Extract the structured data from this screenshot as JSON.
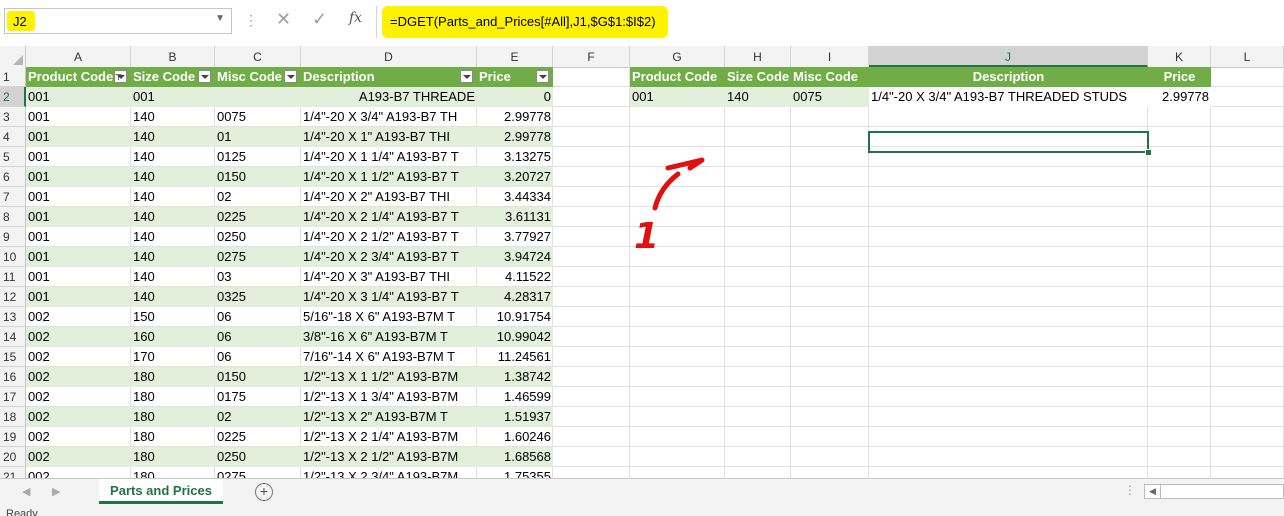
{
  "name_box": "J2",
  "formula": "=DGET(Parts_and_Prices[#All],J1,$G$1:$I$2)",
  "formula_bar_icons": {
    "cancel": "✕",
    "enter": "✓",
    "fx": "fx"
  },
  "columns": [
    "A",
    "B",
    "C",
    "D",
    "E",
    "F",
    "G",
    "H",
    "I",
    "J",
    "K",
    "L"
  ],
  "rows": [
    "1",
    "2",
    "3",
    "4",
    "5",
    "6",
    "7",
    "8",
    "9",
    "10",
    "11",
    "12",
    "13",
    "14",
    "15",
    "16",
    "17",
    "18",
    "19",
    "20",
    "21"
  ],
  "table_headers": [
    "Product Code",
    "Size Code",
    "Misc Code",
    "Description",
    "Price"
  ],
  "table_rows": [
    [
      "001",
      "001",
      "",
      "A193-B7 THREADE",
      "0"
    ],
    [
      "001",
      "140",
      "0075",
      "1/4\"-20 X 3/4\"      A193-B7 TH",
      "2.99778"
    ],
    [
      "001",
      "140",
      "01",
      "1/4\"-20 X 1\"       A193-B7 THI",
      "2.99778"
    ],
    [
      "001",
      "140",
      "0125",
      "1/4\"-20 X 1 1/4\"    A193-B7 T",
      "3.13275"
    ],
    [
      "001",
      "140",
      "0150",
      "1/4\"-20 X 1 1/2\"    A193-B7 T",
      "3.20727"
    ],
    [
      "001",
      "140",
      "02",
      "1/4\"-20 X 2\"       A193-B7 THI",
      "3.44334"
    ],
    [
      "001",
      "140",
      "0225",
      "1/4\"-20 X 2 1/4\"    A193-B7 T",
      "3.61131"
    ],
    [
      "001",
      "140",
      "0250",
      "1/4\"-20 X 2 1/2\"    A193-B7 T",
      "3.77927"
    ],
    [
      "001",
      "140",
      "0275",
      "1/4\"-20 X 2 3/4\"    A193-B7 T",
      "3.94724"
    ],
    [
      "001",
      "140",
      "03",
      "1/4\"-20 X 3\"       A193-B7 THI",
      "4.11522"
    ],
    [
      "001",
      "140",
      "0325",
      "1/4\"-20 X 3 1/4\"    A193-B7 T",
      "4.28317"
    ],
    [
      "002",
      "150",
      "06",
      "5/16\"-18 X 6\"      A193-B7M T",
      "10.91754"
    ],
    [
      "002",
      "160",
      "06",
      "3/8\"-16 X 6\"       A193-B7M T",
      "10.99042"
    ],
    [
      "002",
      "170",
      "06",
      "7/16\"-14 X 6\"      A193-B7M T",
      "11.24561"
    ],
    [
      "002",
      "180",
      "0150",
      "1/2\"-13 X 1 1/2\"    A193-B7M",
      "1.38742"
    ],
    [
      "002",
      "180",
      "0175",
      "1/2\"-13 X 1 3/4\"    A193-B7M",
      "1.46599"
    ],
    [
      "002",
      "180",
      "02",
      "1/2\"-13 X 2\"       A193-B7M T",
      "1.51937"
    ],
    [
      "002",
      "180",
      "0225",
      "1/2\"-13 X 2 1/4\"    A193-B7M",
      "1.60246"
    ],
    [
      "002",
      "180",
      "0250",
      "1/2\"-13 X 2 1/2\"    A193-B7M",
      "1.68568"
    ],
    [
      "002",
      "180",
      "0275",
      "1/2\"-13 X 2 3/4\"    A193-B7M",
      "1.75355"
    ]
  ],
  "criteria_headers": [
    "Product Code",
    "Size Code",
    "Misc Code",
    "Description",
    "Price"
  ],
  "criteria_values": [
    "001",
    "140",
    "0075",
    "1/4\"-20 X 3/4\"      A193-B7 THREADED STUDS",
    "2.99778"
  ],
  "annotation": "1",
  "sheet_tab": "Parts and Prices",
  "add_sheet": "+",
  "status": "Ready",
  "colors": {
    "table_header": "#70ad47",
    "band": "#e2efda",
    "highlight": "#fff200",
    "annotation": "#e01010",
    "accent": "#217346"
  }
}
